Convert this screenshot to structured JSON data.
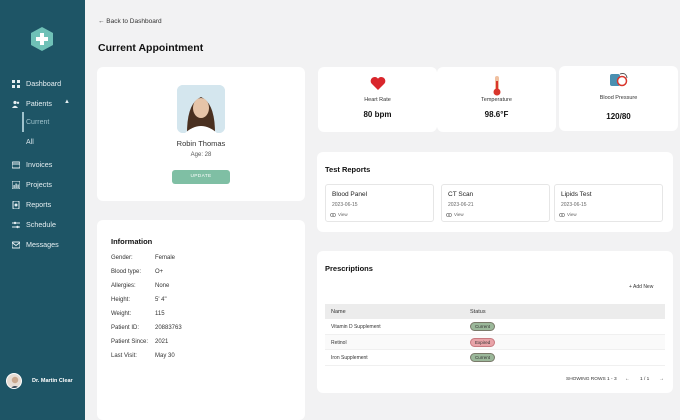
{
  "sidebar": {
    "nav": [
      {
        "label": "Dashboard",
        "icon": "grid-icon"
      },
      {
        "label": "Patients",
        "icon": "users-icon"
      },
      {
        "label": "Invoices",
        "icon": "invoice-icon"
      },
      {
        "label": "Projects",
        "icon": "chart-icon"
      },
      {
        "label": "Reports",
        "icon": "report-icon"
      },
      {
        "label": "Schedule",
        "icon": "schedule-icon"
      },
      {
        "label": "Messages",
        "icon": "message-icon"
      }
    ],
    "patients_sub": [
      "Current",
      "All"
    ],
    "user_name": "Dr. Martin Clear"
  },
  "back_link": "← Back to Dashboard",
  "page_title": "Current Appointment",
  "profile": {
    "name": "Robin Thomas",
    "age": "Age: 28",
    "update_label": "UPDATE"
  },
  "vitals": [
    {
      "label": "Heart Rate",
      "value": "80 bpm",
      "icon": "heart-icon"
    },
    {
      "label": "Temperature",
      "value": "98.6°F",
      "icon": "thermometer-icon"
    },
    {
      "label": "Blood Pressure",
      "value": "120/80",
      "icon": "blood-pressure-icon"
    }
  ],
  "information": {
    "title": "Information",
    "rows": [
      {
        "k": "Gender:",
        "v": "Female"
      },
      {
        "k": "Blood type:",
        "v": "O+"
      },
      {
        "k": "Allergies:",
        "v": "None"
      },
      {
        "k": "Height:",
        "v": "5' 4\""
      },
      {
        "k": "Weight:",
        "v": "115"
      },
      {
        "k": "Patient ID:",
        "v": "20883763"
      },
      {
        "k": "Patient Since:",
        "v": "2021"
      },
      {
        "k": "Last Visit:",
        "v": "May 30"
      }
    ]
  },
  "tests": {
    "title": "Test Reports",
    "items": [
      {
        "name": "Blood Panel",
        "date": "2023-06-15",
        "view": "View"
      },
      {
        "name": "CT Scan",
        "date": "2023-06-21",
        "view": "View"
      },
      {
        "name": "Lipids Test",
        "date": "2023-06-15",
        "view": "View"
      }
    ]
  },
  "prescriptions": {
    "title": "Prescriptions",
    "add_label": "+ Add New",
    "headers": [
      "Name",
      "Status"
    ],
    "rows": [
      {
        "name": "Vitamin D Supplement",
        "status": "Current",
        "color": "#9bb89a"
      },
      {
        "name": "Retinol",
        "status": "Expired",
        "color": "#e8a3a8"
      },
      {
        "name": "Iron Supplement",
        "status": "Current",
        "color": "#9bb89a"
      }
    ],
    "showing": "SHOWING ROWS 1 - 3",
    "page": "1 / 1",
    "prev": "←",
    "next": "→"
  },
  "colors": {
    "sidebar": "#1e5566",
    "accent": "#7fbfa4",
    "heart": "#d9262c"
  }
}
